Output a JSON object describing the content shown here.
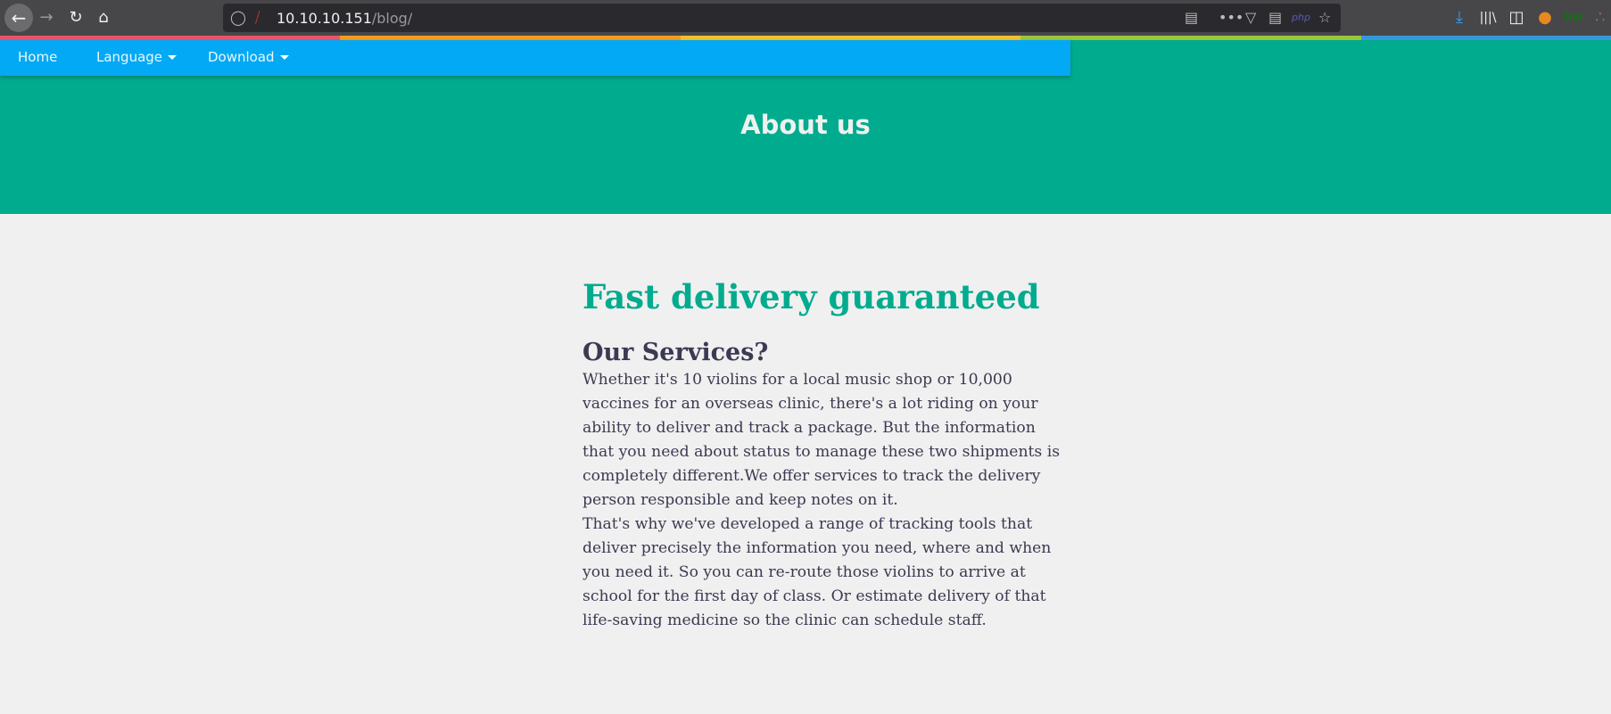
{
  "browser": {
    "url_host": "10.10.10.151",
    "url_path": "/blog/",
    "icons": [
      "back-icon",
      "forward-icon",
      "reload-icon",
      "home-icon",
      "shield-icon",
      "insecure-lock-icon",
      "reader-view-icon",
      "more-icon",
      "pocket-icon",
      "server-icon",
      "php-icon",
      "bookmark-star-icon",
      "download-icon",
      "library-icon",
      "sidebar-icon",
      "extension-icon",
      "bw-icon",
      "extension-icon-2"
    ],
    "php_label": "php",
    "bw_label": "bw"
  },
  "stripe_colors": [
    "#e9546b",
    "#f39c1f",
    "#f2c02a",
    "#9bc53d",
    "#3498db"
  ],
  "nav": {
    "items": [
      {
        "label": "Home"
      },
      {
        "label": "Language"
      },
      {
        "label": "Download"
      }
    ]
  },
  "hero": {
    "title": "About us"
  },
  "main": {
    "heading": "Fast delivery guaranteed",
    "subheading": "Our Services?",
    "lines": [
      "Whether it's 10 violins for a local music shop or 10,000",
      "vaccines for an overseas clinic, there's a lot riding on your",
      "ability to deliver and track a package. But the information",
      "that you need about status to manage these two shipments is",
      "completely different.We offer services to track the delivery",
      "person responsible and keep notes on it.",
      "That's why we've developed a range of tracking tools that",
      "deliver precisely the information you need, where and when",
      "you need it. So you can re-route those violins to arrive at",
      "school for the first day of class. Or estimate delivery of that",
      "life-saving medicine so the clinic can schedule staff."
    ]
  },
  "colors": {
    "accent": "#00ab8e",
    "nav": "#03a9f4",
    "text": "#3a3a52"
  }
}
